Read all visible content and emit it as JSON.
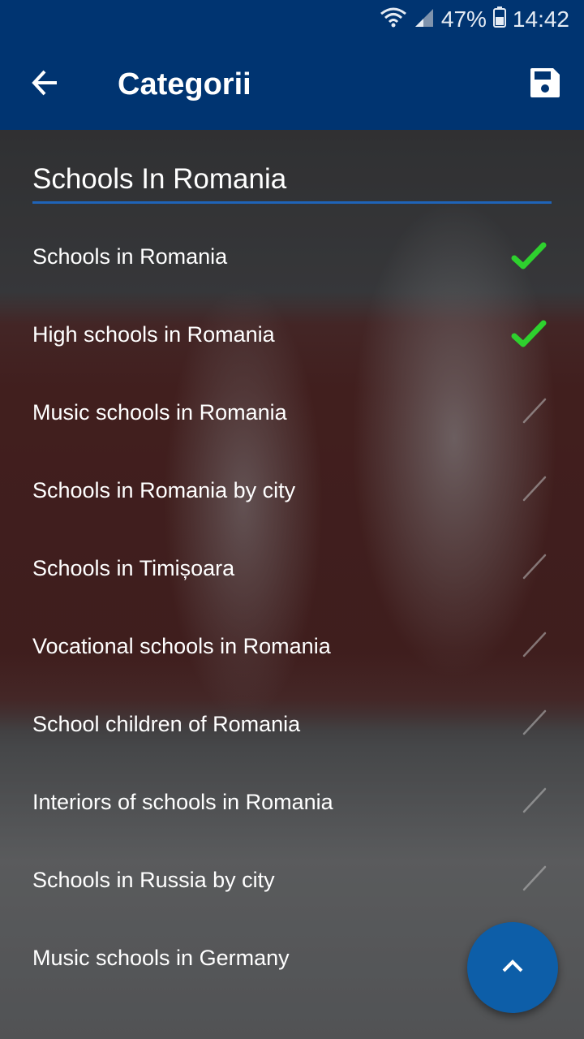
{
  "status_bar": {
    "battery": "47%",
    "time": "14:42",
    "icons": [
      "wifi-icon",
      "signal-icon",
      "battery-icon"
    ]
  },
  "app_bar": {
    "title": "Categorii",
    "back_icon": "arrow-left-icon",
    "save_icon": "floppy-disk-icon"
  },
  "search": {
    "value": "Schools In Romania"
  },
  "categories": [
    {
      "label": "Schools in Romania",
      "checked": true
    },
    {
      "label": "High schools in Romania",
      "checked": true
    },
    {
      "label": "Music schools in Romania",
      "checked": false
    },
    {
      "label": "Schools in Romania by city",
      "checked": false
    },
    {
      "label": "Schools in Timișoara",
      "checked": false
    },
    {
      "label": "Vocational schools in Romania",
      "checked": false
    },
    {
      "label": "School children of Romania",
      "checked": false
    },
    {
      "label": "Interiors of schools in Romania",
      "checked": false
    },
    {
      "label": "Schools in Russia by city",
      "checked": false
    },
    {
      "label": "Music schools in Germany",
      "checked": false
    }
  ],
  "fab": {
    "icon": "chevron-up-icon"
  },
  "colors": {
    "primary": "#003471",
    "accent": "#1f64b8",
    "check_active": "#2ed12e",
    "fab": "#0d5ea8"
  }
}
